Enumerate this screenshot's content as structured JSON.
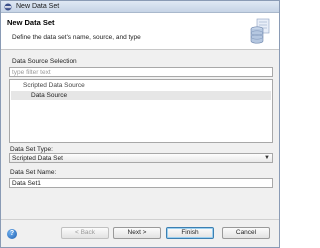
{
  "window": {
    "title": "New Data Set",
    "icon": "eclipse-icon"
  },
  "header": {
    "title": "New Data Set",
    "description": "Define the data set's name, source, and type",
    "icon": "database-wizard-icon"
  },
  "data_source": {
    "label": "Data Source Selection",
    "filter_placeholder": "type filter text",
    "tree": [
      {
        "label": "Scripted Data Source",
        "level": 0
      },
      {
        "label": "Data Source",
        "level": 1,
        "selected": true
      }
    ]
  },
  "data_set_type": {
    "label": "Data Set Type:",
    "selected": "Scripted Data Set"
  },
  "data_set_name": {
    "label": "Data Set Name:",
    "value": "Data Set1"
  },
  "buttons": {
    "help": "?",
    "back": "< Back",
    "next": "Next >",
    "finish": "Finish",
    "cancel": "Cancel"
  },
  "colors": {
    "title_bar": "#c6d4e6",
    "dialog_bg": "#f0f0f0",
    "selected_row": "#e6e6e6"
  }
}
